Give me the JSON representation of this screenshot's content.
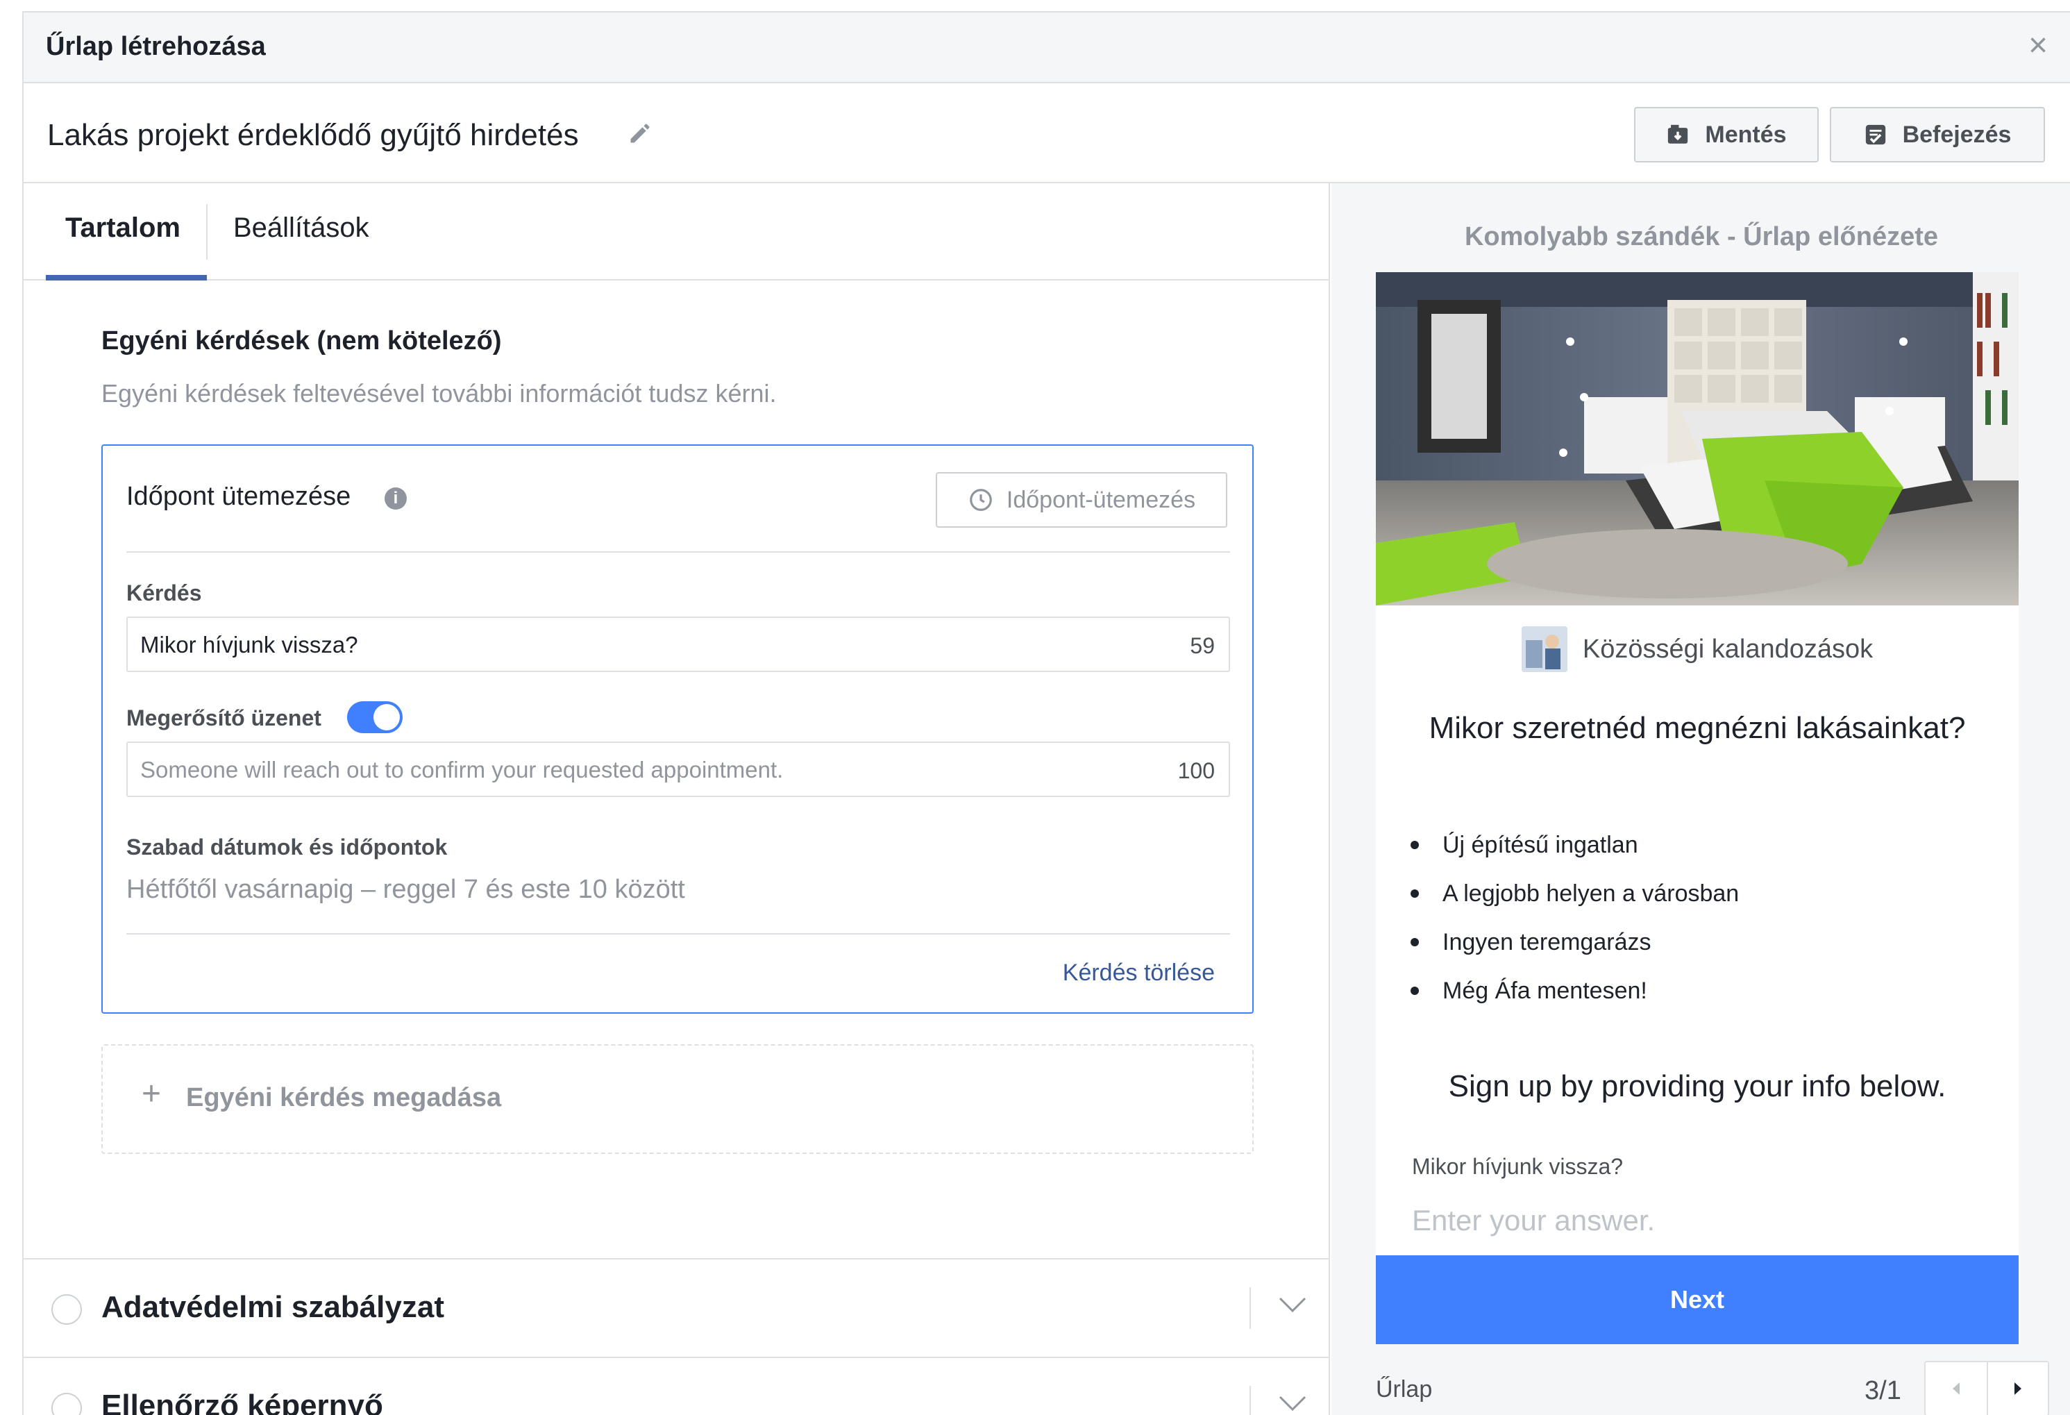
{
  "dialog": {
    "title": "Űrlap létrehozása",
    "close_label": "×"
  },
  "form": {
    "name": "Lakás projekt érdeklődő gyűjtő hirdetés"
  },
  "toolbar": {
    "save_label": "Mentés",
    "finish_label": "Befejezés"
  },
  "tabs": [
    {
      "label": "Tartalom",
      "active": true
    },
    {
      "label": "Beállítások",
      "active": false
    }
  ],
  "section": {
    "title": "Egyéni kérdések (nem kötelező)",
    "description": "Egyéni kérdések feltevésével további információt tudsz kérni."
  },
  "question": {
    "type_title": "Időpont ütemezése",
    "info_glyph": "i",
    "type_button": "Időpont-ütemezés",
    "question_label": "Kérdés",
    "question_value": "Mikor hívjunk vissza?",
    "question_count": "59",
    "confirm_label": "Megerősítő üzenet",
    "confirm_enabled": true,
    "confirm_placeholder": "Someone will reach out to confirm your requested appointment.",
    "confirm_count": "100",
    "availability_label": "Szabad dátumok és időpontok",
    "availability_value": "Hétfőtől vasárnapig – reggel 7 és este 10 között",
    "delete_label": "Kérdés törlése"
  },
  "add_question": {
    "plus": "+",
    "label": "Egyéni kérdés megadása"
  },
  "accordion": [
    {
      "title": "Adatvédelmi szabályzat"
    },
    {
      "title": "Ellenőrző képernyő"
    }
  ],
  "preview": {
    "title": "Komolyabb szándék - Űrlap előnézete",
    "page_name": "Közösségi kalandozások",
    "headline": "Mikor szeretnéd megnézni lakásainkat?",
    "bullets": [
      "Új építésű ingatlan",
      "A legjobb helyen a városban",
      "Ingyen teremgarázs",
      "Még Áfa mentesen!"
    ],
    "signup_text": "Sign up by providing your info below.",
    "question_label": "Mikor hívjunk vissza?",
    "answer_placeholder": "Enter your answer.",
    "next_label": "Next",
    "footer_label": "Űrlap",
    "page_count": "3/1"
  },
  "colors": {
    "accent": "#4080ff",
    "link": "#365899",
    "tab_underline": "#4267b2",
    "muted": "#90949c"
  }
}
